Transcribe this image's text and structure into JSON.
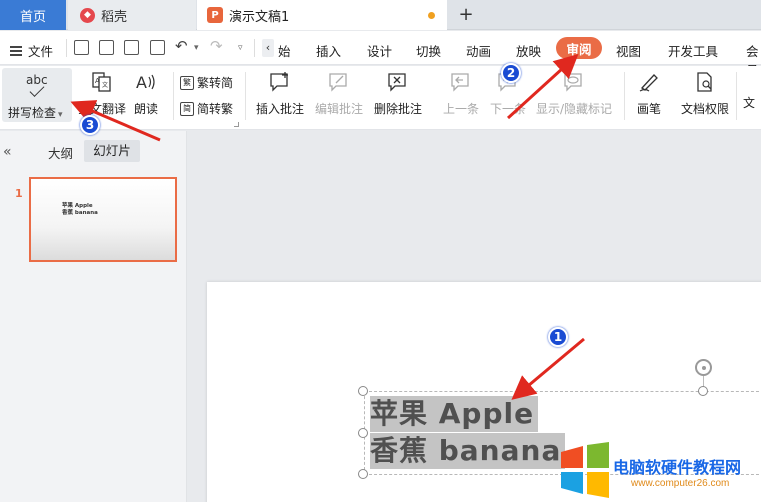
{
  "tabs": {
    "home": "首页",
    "daoke": "稻壳",
    "document": "演示文稿1",
    "add": "+"
  },
  "menu": {
    "file": "文件",
    "back": "‹",
    "items": [
      {
        "label": "始"
      },
      {
        "label": "插入"
      },
      {
        "label": "设计"
      },
      {
        "label": "切换"
      },
      {
        "label": "动画"
      },
      {
        "label": "放映"
      },
      {
        "label": "审阅",
        "active": true
      },
      {
        "label": "视图"
      },
      {
        "label": "开发工具"
      },
      {
        "label": "会员"
      }
    ]
  },
  "ribbon": {
    "spell": {
      "icon_text": "abc",
      "label": "拼写检查"
    },
    "translate": "全文翻译",
    "read_aloud": "朗读",
    "trad_to_simp": "繁转简",
    "simp_to_trad": "简转繁",
    "insert_comment": "插入批注",
    "edit_comment": "编辑批注",
    "delete_comment": "删除批注",
    "prev": "上一条",
    "next": "下一条",
    "show_hide": "显示/隐藏标记",
    "pen": "画笔",
    "doc_perm": "文档权限",
    "doc_more": "文"
  },
  "sidebar": {
    "collapse": "«",
    "outline_tab": "大纲",
    "slides_tab": "幻灯片",
    "slide_number": "1",
    "thumb_line1": "苹果 Apple",
    "thumb_line2": "香蕉 banana"
  },
  "slide": {
    "line1": "苹果 Apple",
    "line2": "香蕉 banana"
  },
  "annotations": {
    "badge1": "1",
    "badge2": "2",
    "badge3": "3",
    "arrow_color": "#e0281f"
  },
  "watermark": {
    "title": "电脑软硬件教程网",
    "url": "www.computer26.com"
  },
  "colors": {
    "accent": "#ea6c46",
    "home_tab": "#3a7bd5",
    "badge": "#1a4bd3"
  }
}
